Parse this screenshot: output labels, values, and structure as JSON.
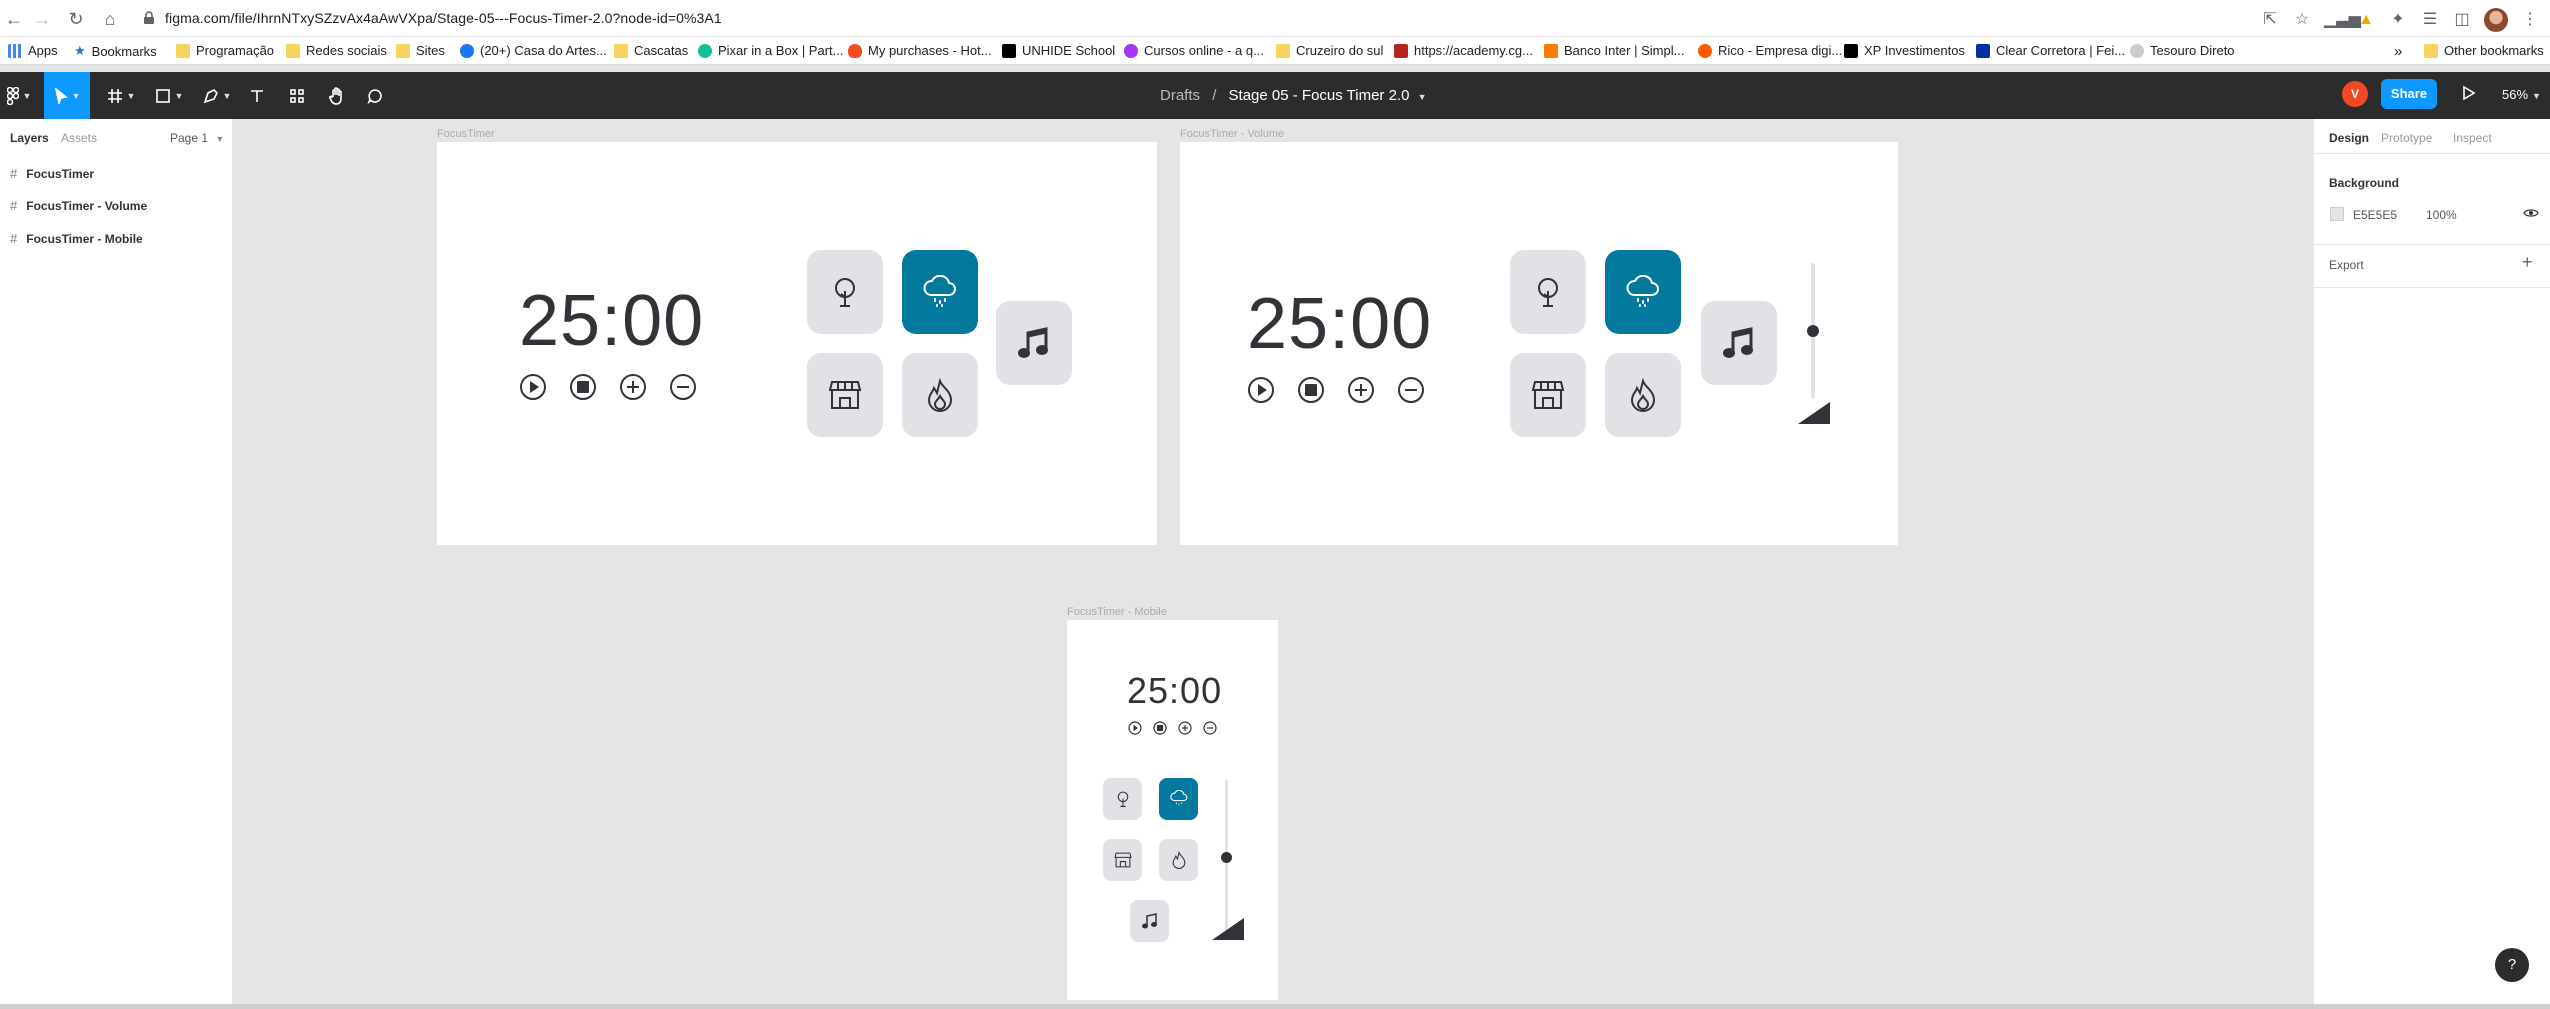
{
  "browser": {
    "url": "figma.com/file/IhrnNTxySZzvAx4aAwVXpa/Stage-05---Focus-Timer-2.0?node-id=0%3A1",
    "bookmarks": [
      "Apps",
      "Bookmarks",
      "Programação",
      "Redes sociais",
      "Sites",
      "(20+) Casa do Artes...",
      "Cascatas",
      "Pixar in a Box | Part...",
      "My purchases - Hot...",
      "UNHIDE School",
      "Cursos online - a q...",
      "Cruzeiro do sul",
      "https://academy.cg...",
      "Banco Inter | Simpl...",
      "Rico - Empresa digi...",
      "XP Investimentos",
      "Clear Corretora | Fei...",
      "Tesouro Direto"
    ],
    "more": "»",
    "other_bookmarks": "Other bookmarks"
  },
  "toolbar": {
    "breadcrumb_parent": "Drafts",
    "breadcrumb_sep": "/",
    "file_name": "Stage 05 - Focus Timer 2.0",
    "avatar_letter": "V",
    "share_label": "Share",
    "zoom": "56%"
  },
  "left_panel": {
    "tabs": [
      "Layers",
      "Assets"
    ],
    "page": "Page 1",
    "layers": [
      "FocusTimer",
      "FocusTimer - Volume",
      "FocusTimer - Mobile"
    ]
  },
  "right_panel": {
    "tabs": [
      "Design",
      "Prototype",
      "Inspect"
    ],
    "background_label": "Background",
    "background_hex": "E5E5E5",
    "background_opacity": "100%",
    "export_label": "Export"
  },
  "canvas": {
    "frames": [
      "FocusTimer",
      "FocusTimer - Volume",
      "FocusTimer - Mobile"
    ],
    "timer": "25:00",
    "volume_level": 0.5,
    "accent": "#02799d",
    "card_bg": "#e1e1e6",
    "text_color": "#323238"
  },
  "help": "?"
}
